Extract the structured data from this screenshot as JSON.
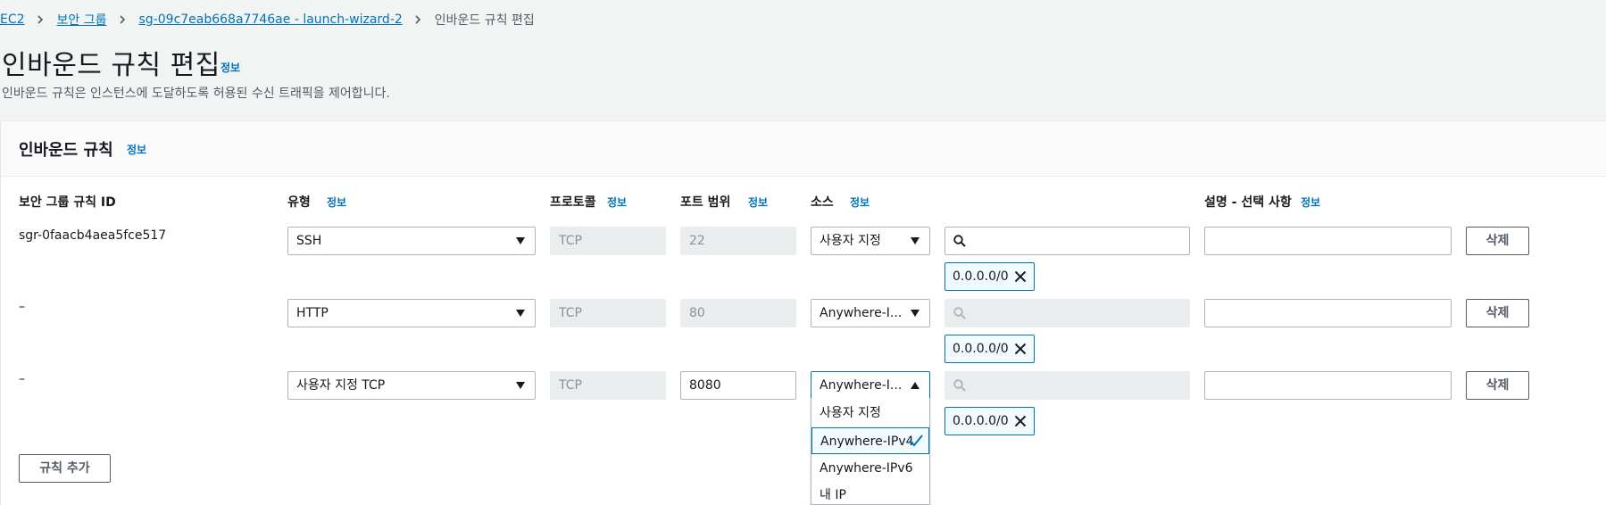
{
  "breadcrumb": {
    "items": [
      "EC2",
      "보안 그룹",
      "sg-09c7eab668a7746ae - launch-wizard-2"
    ],
    "current": "인바운드 규칙 편집"
  },
  "page": {
    "title": "인바운드 규칙 편집",
    "info": "정보",
    "description": "인바운드 규칙은 인스턴스에 도달하도록 허용된 수신 트래픽을 제어합니다."
  },
  "panel": {
    "title": "인바운드 규칙",
    "info": "정보"
  },
  "columns": {
    "rule_id": "보안 그룹 규칙 ID",
    "type": "유형",
    "protocol": "프로토콜",
    "port_range": "포트 범위",
    "source": "소스",
    "description": "설명 - 선택 사항",
    "info": "정보"
  },
  "rules": [
    {
      "id": "sgr-0faacb4aea5fce517",
      "type": "SSH",
      "protocol": "TCP",
      "port": "22",
      "source": "사용자 지정",
      "cidr": "0.0.0.0/0",
      "delete": "삭제"
    },
    {
      "id": "–",
      "type": "HTTP",
      "protocol": "TCP",
      "port": "80",
      "source": "Anywhere-I...",
      "cidr": "0.0.0.0/0",
      "delete": "삭제"
    },
    {
      "id": "–",
      "type": "사용자 지정 TCP",
      "protocol": "TCP",
      "port": "8080",
      "source": "Anywhere-I...",
      "cidr": "0.0.0.0/0",
      "delete": "삭제"
    }
  ],
  "add_rule": "규칙 추가",
  "source_dropdown": {
    "options": [
      "사용자 지정",
      "Anywhere-IPv4",
      "Anywhere-IPv6",
      "내 IP"
    ],
    "selected": "Anywhere-IPv4"
  },
  "colors": {
    "link": "#0073bb",
    "background": "#f2f3f3",
    "panel": "#ffffff",
    "disabled": "#eaeded",
    "token_bg": "#f1faff"
  }
}
